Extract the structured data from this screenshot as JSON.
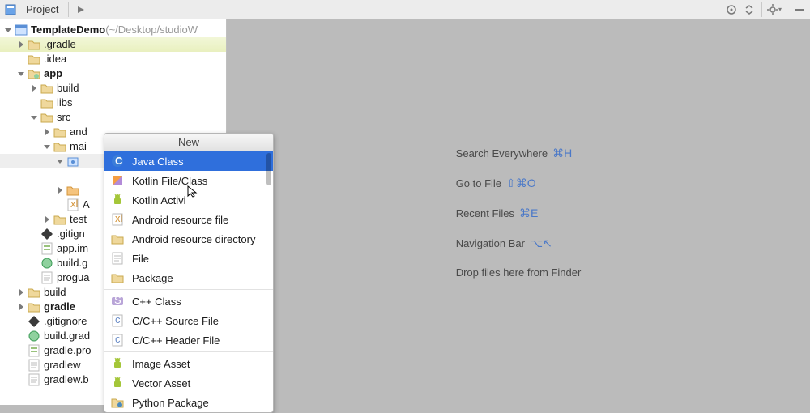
{
  "toolbar": {
    "tab": "Project"
  },
  "tree": [
    {
      "depth": 0,
      "arrow": "down",
      "icon": "module",
      "label": "TemplateDemo",
      "bold": true,
      "suffix": " (~/Desktop/studioW"
    },
    {
      "depth": 1,
      "arrow": "right",
      "icon": "folder",
      "label": ".gradle",
      "sel": true
    },
    {
      "depth": 1,
      "arrow": "none",
      "icon": "folder",
      "label": ".idea"
    },
    {
      "depth": 1,
      "arrow": "down",
      "icon": "app-folder",
      "label": "app",
      "bold": true
    },
    {
      "depth": 2,
      "arrow": "right",
      "icon": "folder",
      "label": "build"
    },
    {
      "depth": 2,
      "arrow": "none",
      "icon": "folder",
      "label": "libs"
    },
    {
      "depth": 2,
      "arrow": "down",
      "icon": "folder",
      "label": "src"
    },
    {
      "depth": 3,
      "arrow": "right",
      "icon": "folder",
      "label": "and"
    },
    {
      "depth": 3,
      "arrow": "down",
      "icon": "folder",
      "label": "mai"
    },
    {
      "depth": 4,
      "arrow": "down",
      "icon": "pkg",
      "label": "",
      "cursor": true
    },
    {
      "depth": 4,
      "arrow": "none",
      "icon": "blank",
      "label": ""
    },
    {
      "depth": 4,
      "arrow": "right",
      "icon": "res",
      "label": ""
    },
    {
      "depth": 4,
      "arrow": "none",
      "icon": "xml",
      "label": "A"
    },
    {
      "depth": 3,
      "arrow": "right",
      "icon": "folder",
      "label": "test"
    },
    {
      "depth": 2,
      "arrow": "none",
      "icon": "git",
      "label": ".gitign"
    },
    {
      "depth": 2,
      "arrow": "none",
      "icon": "prefs",
      "label": "app.im"
    },
    {
      "depth": 2,
      "arrow": "none",
      "icon": "gradle",
      "label": "build.g"
    },
    {
      "depth": 2,
      "arrow": "none",
      "icon": "txt",
      "label": "progua"
    },
    {
      "depth": 1,
      "arrow": "right",
      "icon": "folder",
      "label": "build"
    },
    {
      "depth": 1,
      "arrow": "right",
      "icon": "folder",
      "label": "gradle",
      "bold": true
    },
    {
      "depth": 1,
      "arrow": "none",
      "icon": "git",
      "label": ".gitignore"
    },
    {
      "depth": 1,
      "arrow": "none",
      "icon": "gradle",
      "label": "build.grad"
    },
    {
      "depth": 1,
      "arrow": "none",
      "icon": "prefs",
      "label": "gradle.pro"
    },
    {
      "depth": 1,
      "arrow": "none",
      "icon": "txt",
      "label": "gradlew"
    },
    {
      "depth": 1,
      "arrow": "none",
      "icon": "txt",
      "label": "gradlew.b"
    }
  ],
  "popup": {
    "title": "New",
    "items": [
      {
        "icon": "java",
        "label": "Java Class",
        "hl": true
      },
      {
        "icon": "kotlin",
        "label": "Kotlin File/Class"
      },
      {
        "icon": "android",
        "label": "Kotlin Activi"
      },
      {
        "icon": "xml",
        "label": "Android resource file"
      },
      {
        "icon": "folder",
        "label": "Android resource directory"
      },
      {
        "icon": "txt",
        "label": "File"
      },
      {
        "icon": "folder",
        "label": "Package"
      },
      {
        "sep": true
      },
      {
        "icon": "cpp",
        "label": "C++ Class"
      },
      {
        "icon": "c",
        "label": "C/C++ Source File"
      },
      {
        "icon": "c",
        "label": "C/C++ Header File"
      },
      {
        "sep": true
      },
      {
        "icon": "android",
        "label": "Image Asset"
      },
      {
        "icon": "android",
        "label": "Vector Asset"
      },
      {
        "icon": "py",
        "label": "Python Package"
      }
    ]
  },
  "hints": [
    {
      "text": "Search Everywhere",
      "keys": "⌘H"
    },
    {
      "text": "Go to File",
      "keys": "⇧⌘O"
    },
    {
      "text": "Recent Files",
      "keys": "⌘E"
    },
    {
      "text": "Navigation Bar",
      "keys": "⌥↖"
    },
    {
      "text": "Drop files here from Finder",
      "keys": ""
    }
  ]
}
